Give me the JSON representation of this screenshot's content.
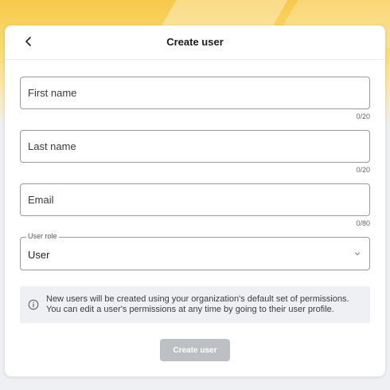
{
  "header": {
    "title": "Create user"
  },
  "form": {
    "first_name": {
      "placeholder": "First name",
      "counter": "0/20"
    },
    "last_name": {
      "placeholder": "Last name",
      "counter": "0/20"
    },
    "email": {
      "placeholder": "Email",
      "counter": "0/80"
    },
    "user_role": {
      "label": "User role",
      "value": "User"
    }
  },
  "info": {
    "line1": "New users will be created using your organization's default set of permissions.",
    "line2": "You can edit a user's permissions at any time by going to their user profile."
  },
  "actions": {
    "create_label": "Create user"
  },
  "icons": {
    "back": "chevron-left-icon",
    "dropdown": "chevron-down-icon",
    "info": "info-icon"
  },
  "colors": {
    "banner": "#f7c94a",
    "button_disabled": "#bcc0c4",
    "info_bg": "#eef0f3"
  }
}
